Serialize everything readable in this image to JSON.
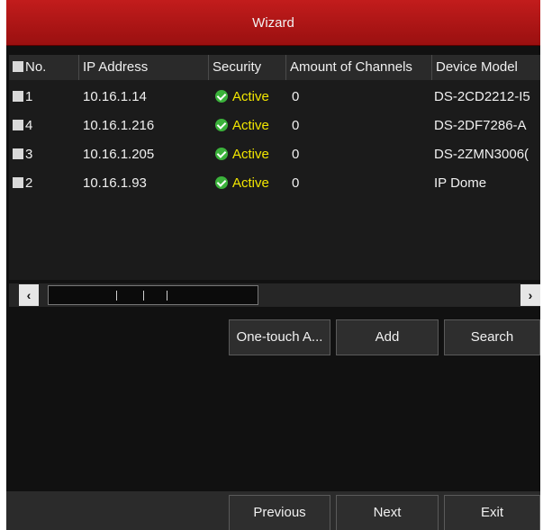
{
  "window": {
    "title": "Wizard"
  },
  "table": {
    "columns": [
      "No.",
      "IP Address",
      "Security",
      "Amount of Channels",
      "Device Model"
    ],
    "rows": [
      {
        "no": "1",
        "ip": "10.16.1.14",
        "security": "Active",
        "channels": "0",
        "model": "DS-2CD2212-I5"
      },
      {
        "no": "4",
        "ip": "10.16.1.216",
        "security": "Active",
        "channels": "0",
        "model": "DS-2DF7286-A"
      },
      {
        "no": "3",
        "ip": "10.16.1.205",
        "security": "Active",
        "channels": "0",
        "model": "DS-2ZMN3006("
      },
      {
        "no": "2",
        "ip": "10.16.1.93",
        "security": "Active",
        "channels": "0",
        "model": "IP Dome"
      }
    ]
  },
  "scrollbar": {
    "left_arrow": "‹",
    "right_arrow": "›"
  },
  "actions": {
    "one_touch": "One-touch A...",
    "add": "Add",
    "search": "Search"
  },
  "footer": {
    "previous": "Previous",
    "next": "Next",
    "exit": "Exit"
  },
  "colors": {
    "title_bar": "#b01616",
    "active_text": "#f2e600",
    "active_icon": "#3bb23b"
  },
  "icons": {
    "status": "check-circle-icon",
    "checkbox": "checkbox-icon"
  }
}
